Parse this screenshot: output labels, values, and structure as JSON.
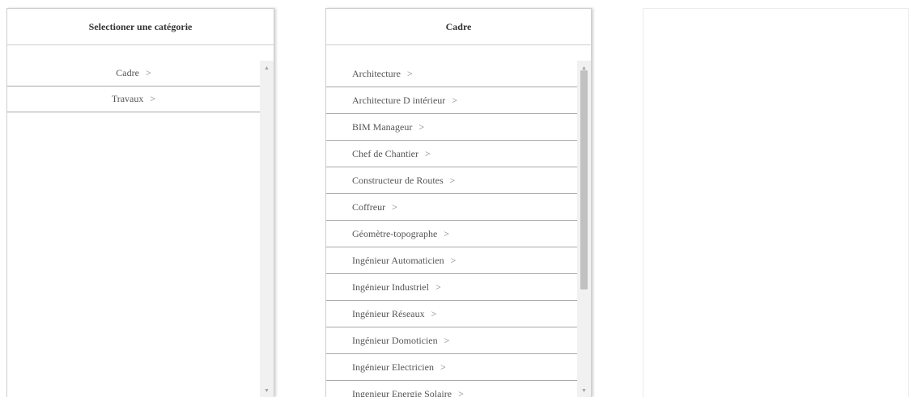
{
  "category_panel": {
    "title": "Selectioner une catégorie",
    "items": [
      {
        "label": "Cadre"
      },
      {
        "label": "Travaux"
      }
    ]
  },
  "subcategory_panel": {
    "title": "Cadre",
    "items": [
      {
        "label": "Architecture"
      },
      {
        "label": "Architecture D intérieur"
      },
      {
        "label": "BIM Manageur"
      },
      {
        "label": "Chef de Chantier"
      },
      {
        "label": "Constructeur de Routes"
      },
      {
        "label": "Coffreur"
      },
      {
        "label": "Géomètre-topographe"
      },
      {
        "label": "Ingénieur Automaticien"
      },
      {
        "label": "Ingénieur Industriel"
      },
      {
        "label": "Ingénieur Réseaux"
      },
      {
        "label": "Ingénieur Domoticien"
      },
      {
        "label": "Ingénieur Electricien"
      },
      {
        "label": "Ingenieur Energie Solaire"
      }
    ]
  },
  "chevron_glyph": ">",
  "scroll_glyphs": {
    "up": "▲",
    "down": "▼"
  },
  "colors": {
    "divider": "#a9a9a9",
    "text": "#555555",
    "scrollbar_thumb": "#c1c1c1"
  }
}
